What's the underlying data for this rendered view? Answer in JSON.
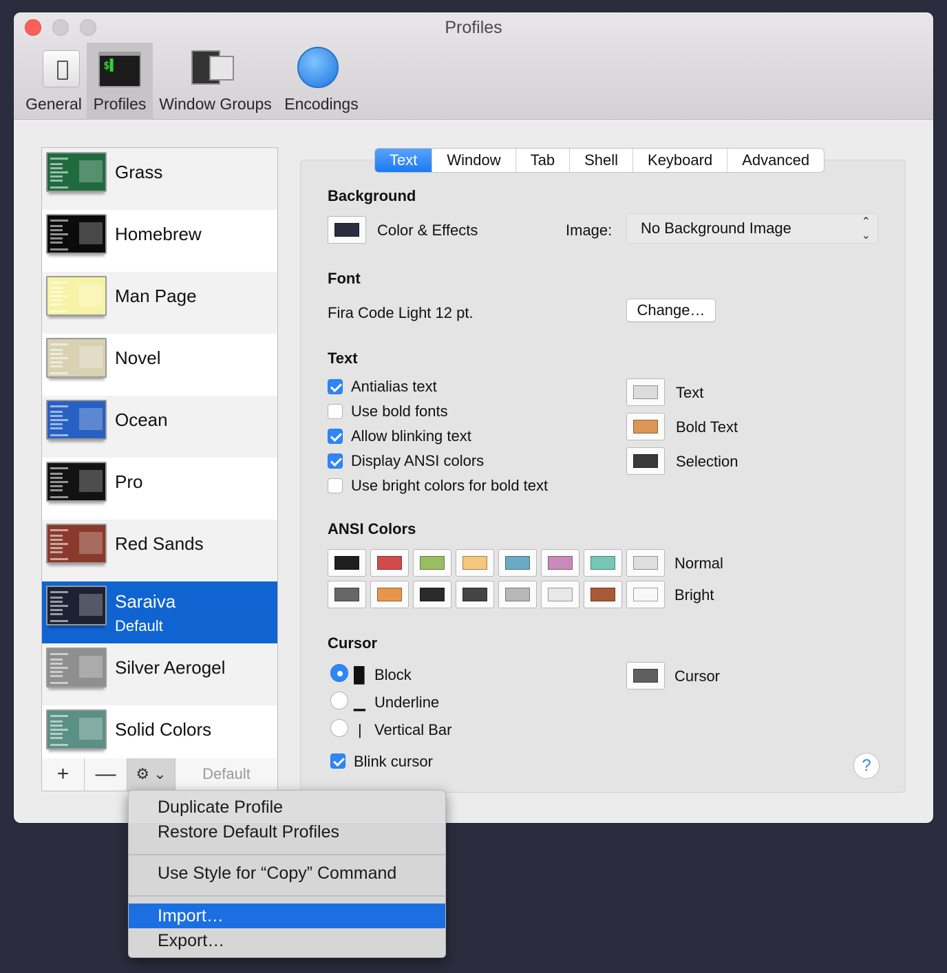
{
  "window": {
    "title": "Profiles"
  },
  "toolbar": {
    "items": [
      {
        "label": "General"
      },
      {
        "label": "Profiles"
      },
      {
        "label": "Window Groups"
      },
      {
        "label": "Encodings"
      }
    ],
    "term_glyph": "$▌"
  },
  "profiles": [
    {
      "name": "Grass",
      "bg": "#1f6b3f"
    },
    {
      "name": "Homebrew",
      "bg": "#0b0b0b"
    },
    {
      "name": "Man Page",
      "bg": "#f7f3a6"
    },
    {
      "name": "Novel",
      "bg": "#d8d2b3"
    },
    {
      "name": "Ocean",
      "bg": "#2760c2"
    },
    {
      "name": "Pro",
      "bg": "#121212"
    },
    {
      "name": "Red Sands",
      "bg": "#8a3a2a"
    },
    {
      "name": "Saraiva",
      "default_label": "Default",
      "bg": "#1d2233",
      "selected": true
    },
    {
      "name": "Silver Aerogel",
      "bg": "#8f8f8f"
    },
    {
      "name": "Solid Colors",
      "bg": "#5a9086"
    }
  ],
  "list_bar": {
    "plus": "+",
    "minus": "—",
    "gear": "⚙ ⌄",
    "default": "Default"
  },
  "tabs": [
    "Text",
    "Window",
    "Tab",
    "Shell",
    "Keyboard",
    "Advanced"
  ],
  "background": {
    "heading": "Background",
    "color_effects_label": "Color & Effects",
    "color": "#2b2d3e",
    "image_label": "Image:",
    "image_value": "No Background Image"
  },
  "font": {
    "heading": "Font",
    "value": "Fira Code Light 12 pt.",
    "change_label": "Change…"
  },
  "text": {
    "heading": "Text",
    "options": [
      {
        "label": "Antialias text",
        "checked": true
      },
      {
        "label": "Use bold fonts",
        "checked": false
      },
      {
        "label": "Allow blinking text",
        "checked": true
      },
      {
        "label": "Display ANSI colors",
        "checked": true
      },
      {
        "label": "Use bright colors for bold text",
        "checked": false
      }
    ],
    "colors": [
      {
        "label": "Text",
        "color": "#dcdcdc"
      },
      {
        "label": "Bold Text",
        "color": "#dc9656"
      },
      {
        "label": "Selection",
        "color": "#3a3a3a"
      }
    ]
  },
  "ansi": {
    "heading": "ANSI Colors",
    "normal_label": "Normal",
    "bright_label": "Bright",
    "normal": [
      "#1e1e1e",
      "#d24a4a",
      "#97be63",
      "#f5c77e",
      "#6aaac4",
      "#c88ab8",
      "#76c7b7",
      "#dedede"
    ],
    "bright": [
      "#666666",
      "#e8964a",
      "#2b2b2b",
      "#444444",
      "#b8b8b8",
      "#e8e8e8",
      "#a85a37",
      "#f8f8f8"
    ]
  },
  "cursor": {
    "heading": "Cursor",
    "options": [
      {
        "glyph": "█",
        "label": "Block",
        "selected": true
      },
      {
        "glyph": "▁",
        "label": "Underline",
        "selected": false
      },
      {
        "glyph": "|",
        "label": "Vertical Bar",
        "selected": false
      }
    ],
    "blink_label": "Blink cursor",
    "blink_checked": true,
    "color_label": "Cursor",
    "color": "#5f5f5f"
  },
  "help": "?",
  "menu": {
    "items": [
      {
        "label": "Duplicate Profile"
      },
      {
        "label": "Restore Default Profiles"
      },
      {
        "label": "Use Style for “Copy” Command"
      },
      {
        "label": "Import…",
        "highlighted": true
      },
      {
        "label": "Export…"
      }
    ]
  }
}
